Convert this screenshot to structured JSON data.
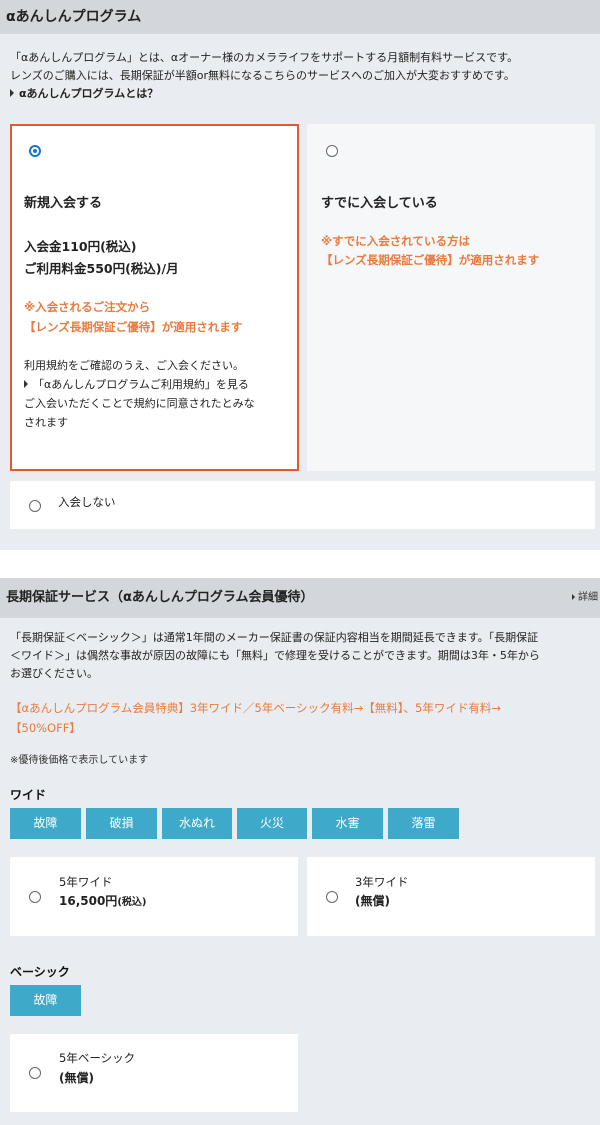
{
  "program": {
    "header": "αあんしんプログラム",
    "intro_lines": [
      "「αあんしんプログラム」とは、αオーナー様のカメラライフをサポートする月額制有料サービスです。",
      "レンズのご購入には、長期保証が半額or無料になるこちらのサービスへのご加入が大変おすすめです。"
    ],
    "about_link": "αあんしんプログラムとは？",
    "options": {
      "new": {
        "title": "新規入会する",
        "fee_line1": "入会金110円(税込)",
        "fee_line2": "ご利用料金550円(税込)/月",
        "note_line1": "※入会されるご注文から",
        "note_line2": "【レンズ長期保証ご優待】が適用されます",
        "terms_line": "利用規約をご確認のうえ、ご入会ください。",
        "terms_link": "「αあんしんプログラムご利用規約」を見る",
        "agree_line1": "ご入会いただくことで規約に同意されたとみな",
        "agree_line2": "されます",
        "selected": true
      },
      "existing": {
        "title": "すでに入会している",
        "note_line1": "※すでに入会されている方は",
        "note_line2": "【レンズ長期保証ご優待】が適用されます",
        "selected": false
      },
      "none": {
        "label": "入会しない",
        "selected": false
      }
    }
  },
  "warranty": {
    "header": "長期保証サービス（αあんしんプログラム会員優待）",
    "detail_link": "詳細",
    "desc_lines": [
      "「長期保証＜ベーシック＞」は通常1年間のメーカー保証書の保証内容相当を期間延長できます。「長期保証",
      "＜ワイド＞」は偶然な事故が原因の故障にも「無料」で修理を受けることができます。期間は3年・5年から",
      "お選びください。"
    ],
    "promo_lines": [
      "【αあんしんプログラム会員特典】3年ワイド／5年ベーシック有料→【無料】、5年ワイド有料→",
      "【50%OFF】"
    ],
    "price_note": "※優待後価格で表示しています",
    "wide": {
      "label": "ワイド",
      "tags": [
        "故障",
        "破損",
        "水ぬれ",
        "火災",
        "水害",
        "落雷"
      ],
      "plans": [
        {
          "name": "5年ワイド",
          "price": "16,500円",
          "tax": "(税込)",
          "selected": false
        },
        {
          "name": "3年ワイド",
          "price": "(無償)",
          "selected": false
        }
      ]
    },
    "basic": {
      "label": "ベーシック",
      "tags": [
        "故障"
      ],
      "plans": [
        {
          "name": "5年ベーシック",
          "price": "(無償)",
          "selected": false
        }
      ]
    }
  },
  "colors": {
    "accent_orange": "#e87b3f",
    "selected_border": "#e25a32",
    "chip_blue": "#3ea9c8",
    "radio_blue": "#1a73c9"
  }
}
